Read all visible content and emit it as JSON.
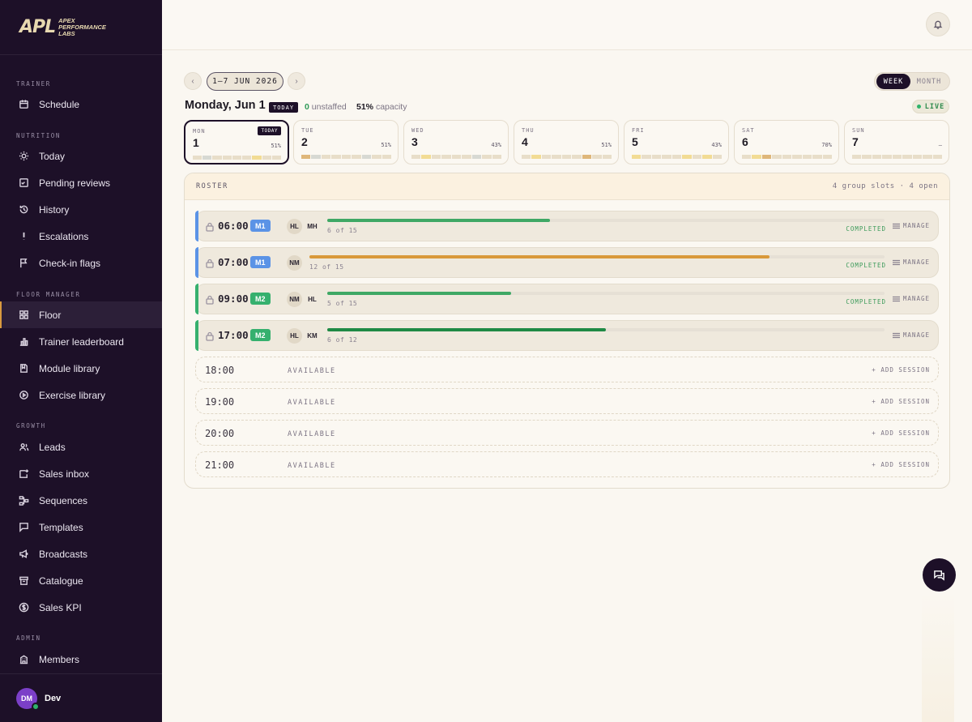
{
  "brand": {
    "mark": "APL",
    "line1": "APEX",
    "line2": "PERFORMANCE",
    "line3": "LABS"
  },
  "sidebar": {
    "sections": [
      {
        "title": "TRAINER",
        "items": [
          {
            "label": "Schedule",
            "icon": "calendar-icon"
          }
        ]
      },
      {
        "title": "NUTRITION",
        "items": [
          {
            "label": "Today",
            "icon": "sun-icon"
          },
          {
            "label": "Pending reviews",
            "icon": "checklist-icon"
          },
          {
            "label": "History",
            "icon": "history-icon"
          },
          {
            "label": "Escalations",
            "icon": "exclamation-icon"
          },
          {
            "label": "Check-in flags",
            "icon": "flag-icon"
          }
        ]
      },
      {
        "title": "FLOOR MANAGER",
        "items": [
          {
            "label": "Floor",
            "icon": "grid-icon",
            "active": true
          },
          {
            "label": "Trainer leaderboard",
            "icon": "bar-chart-icon"
          },
          {
            "label": "Module library",
            "icon": "book-icon"
          },
          {
            "label": "Exercise library",
            "icon": "play-circle-icon"
          }
        ]
      },
      {
        "title": "GROWTH",
        "items": [
          {
            "label": "Leads",
            "icon": "users-icon"
          },
          {
            "label": "Sales inbox",
            "icon": "inbox-icon"
          },
          {
            "label": "Sequences",
            "icon": "sequence-icon"
          },
          {
            "label": "Templates",
            "icon": "message-icon"
          },
          {
            "label": "Broadcasts",
            "icon": "megaphone-icon"
          },
          {
            "label": "Catalogue",
            "icon": "archive-icon"
          },
          {
            "label": "Sales KPI",
            "icon": "dollar-icon"
          }
        ]
      },
      {
        "title": "ADMIN",
        "items": [
          {
            "label": "Members",
            "icon": "building-icon"
          }
        ]
      }
    ],
    "user": {
      "initials": "DM",
      "name": "Dev"
    }
  },
  "header": {
    "prev": "‹",
    "next": "›",
    "range": "1–7 JUN 2026",
    "view_week": "WEEK",
    "view_month": "MONTH",
    "date_title": "Monday, Jun 1",
    "today_badge": "TODAY",
    "unstaffed_count": "0",
    "unstaffed_label": "unstaffed",
    "capacity_pct": "51%",
    "capacity_label": "capacity",
    "live": "LIVE"
  },
  "days": [
    {
      "abbr": "MON",
      "num": "1",
      "pct": "51%",
      "today": "TODAY",
      "selected": true,
      "segments": [
        "#e8dec9",
        "#d7d9d3",
        "#e8dec9",
        "#e8dec9",
        "#e8dec9",
        "#e8dec9",
        "#f2dc94",
        "#e8dec9",
        "#e8dec9"
      ]
    },
    {
      "abbr": "TUE",
      "num": "2",
      "pct": "51%",
      "segments": [
        "#dfb77a",
        "#d7d9d3",
        "#e8dec9",
        "#e8dec9",
        "#e8dec9",
        "#e8dec9",
        "#d7d9d3",
        "#e8dec9",
        "#e8dec9"
      ]
    },
    {
      "abbr": "WED",
      "num": "3",
      "pct": "43%",
      "segments": [
        "#e8dec9",
        "#f2dc94",
        "#e8dec9",
        "#e8dec9",
        "#e8dec9",
        "#e8dec9",
        "#d7d9d3",
        "#e8dec9",
        "#e8dec9"
      ]
    },
    {
      "abbr": "THU",
      "num": "4",
      "pct": "51%",
      "segments": [
        "#e8dec9",
        "#f2dc94",
        "#e8dec9",
        "#e8dec9",
        "#e8dec9",
        "#e8dec9",
        "#dfb77a",
        "#e8dec9",
        "#e8dec9"
      ]
    },
    {
      "abbr": "FRI",
      "num": "5",
      "pct": "43%",
      "segments": [
        "#f2dc94",
        "#e8dec9",
        "#e8dec9",
        "#e8dec9",
        "#e8dec9",
        "#f2dc94",
        "#e8dec9",
        "#f2dc94",
        "#e8dec9"
      ]
    },
    {
      "abbr": "SAT",
      "num": "6",
      "pct": "70%",
      "segments": [
        "#e8dec9",
        "#f2dc94",
        "#dfb77a",
        "#e8dec9",
        "#e8dec9",
        "#e8dec9",
        "#e8dec9",
        "#e8dec9",
        "#e8dec9"
      ]
    },
    {
      "abbr": "SUN",
      "num": "7",
      "pct": "–",
      "segments": [
        "#e8dec9",
        "#e8dec9",
        "#e8dec9",
        "#e8dec9",
        "#e8dec9",
        "#e8dec9",
        "#e8dec9",
        "#e8dec9",
        "#e8dec9"
      ]
    }
  ],
  "roster": {
    "title": "ROSTER",
    "summary": "4 group slots · 4 open",
    "sessions": [
      {
        "time": "06:00",
        "module": "M1",
        "module_color": "#5b93e6",
        "accent": "#5b93e6",
        "initials": [
          "HL",
          "MH"
        ],
        "count": "6 of 15",
        "fill": 0.4,
        "fill_color": "#3fa865",
        "status": "COMPLETED",
        "manage": "MANAGE"
      },
      {
        "time": "07:00",
        "module": "M1",
        "module_color": "#5b93e6",
        "accent": "#5b93e6",
        "initials": [
          "NM"
        ],
        "count": "12 of 15",
        "fill": 0.8,
        "fill_color": "#d9993a",
        "status": "COMPLETED",
        "manage": "MANAGE"
      },
      {
        "time": "09:00",
        "module": "M2",
        "module_color": "#36b06e",
        "accent": "#36b06e",
        "initials": [
          "NM",
          "HL"
        ],
        "count": "5 of 15",
        "fill": 0.33,
        "fill_color": "#3fa865",
        "status": "COMPLETED",
        "manage": "MANAGE"
      },
      {
        "time": "17:00",
        "module": "M2",
        "module_color": "#36b06e",
        "accent": "#36b06e",
        "initials": [
          "HL",
          "KM"
        ],
        "count": "6 of 12",
        "fill": 0.5,
        "fill_color": "#1f8a45",
        "status": "",
        "manage": "MANAGE"
      }
    ],
    "available": [
      {
        "time": "18:00",
        "label": "AVAILABLE",
        "action": "+ ADD SESSION"
      },
      {
        "time": "19:00",
        "label": "AVAILABLE",
        "action": "+ ADD SESSION"
      },
      {
        "time": "20:00",
        "label": "AVAILABLE",
        "action": "+ ADD SESSION"
      },
      {
        "time": "21:00",
        "label": "AVAILABLE",
        "action": "+ ADD SESSION"
      }
    ]
  }
}
